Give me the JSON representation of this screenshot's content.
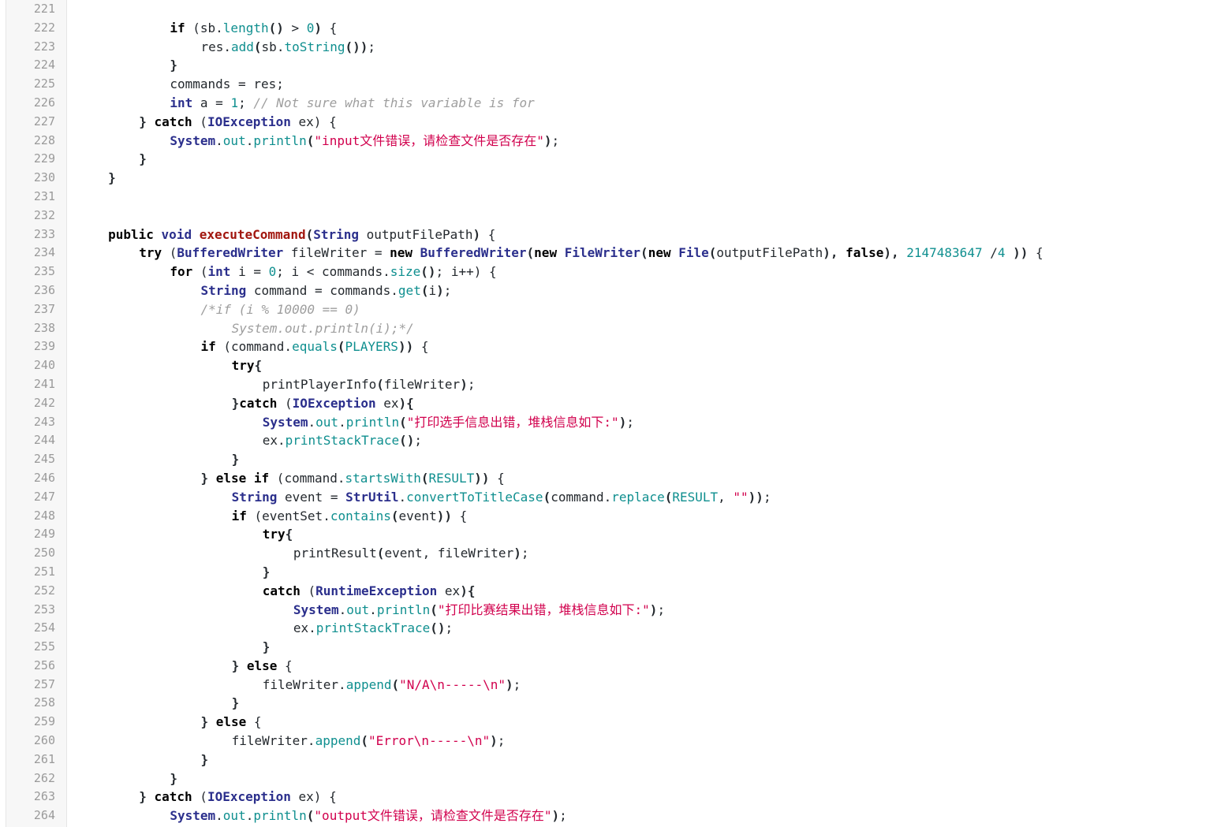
{
  "colors": {
    "keyword": "#000000",
    "type": "#2b2f8c",
    "method": "#0f8f8f",
    "number": "#0f8f8f",
    "string": "#d1004d",
    "comment": "#9e9e9e",
    "declaration": "#a1160e",
    "plain": "#24292e",
    "gutter_bg": "#f7f7f7",
    "line_number": "#9a9a9a"
  },
  "lines": [
    {
      "n": "221",
      "indent": 0,
      "tokens": []
    },
    {
      "n": "222",
      "indent": 12,
      "tokens": [
        [
          "k",
          "if"
        ],
        [
          "p",
          " ("
        ],
        [
          "p",
          "sb."
        ],
        [
          "f",
          "length"
        ],
        [
          "o",
          "()"
        ],
        [
          "p",
          " > "
        ],
        [
          "n",
          "0"
        ],
        [
          "o",
          ")"
        ],
        [
          "p",
          " {"
        ]
      ]
    },
    {
      "n": "223",
      "indent": 16,
      "tokens": [
        [
          "p",
          "res."
        ],
        [
          "f",
          "add"
        ],
        [
          "o",
          "("
        ],
        [
          "p",
          "sb."
        ],
        [
          "f",
          "toString"
        ],
        [
          "o",
          "())"
        ],
        [
          "p",
          ";"
        ]
      ]
    },
    {
      "n": "224",
      "indent": 12,
      "tokens": [
        [
          "o",
          "}"
        ]
      ]
    },
    {
      "n": "225",
      "indent": 12,
      "tokens": [
        [
          "p",
          "commands = res;"
        ]
      ]
    },
    {
      "n": "226",
      "indent": 12,
      "tokens": [
        [
          "t",
          "int"
        ],
        [
          "p",
          " a = "
        ],
        [
          "n",
          "1"
        ],
        [
          "p",
          "; "
        ],
        [
          "c",
          "// Not sure what this variable is for"
        ]
      ]
    },
    {
      "n": "227",
      "indent": 8,
      "tokens": [
        [
          "o",
          "} "
        ],
        [
          "k",
          "catch"
        ],
        [
          "p",
          " ("
        ],
        [
          "t",
          "IOException"
        ],
        [
          "p",
          " ex) {"
        ]
      ]
    },
    {
      "n": "228",
      "indent": 12,
      "tokens": [
        [
          "t",
          "System"
        ],
        [
          "p",
          "."
        ],
        [
          "f",
          "out"
        ],
        [
          "p",
          "."
        ],
        [
          "f",
          "println"
        ],
        [
          "o",
          "("
        ],
        [
          "s",
          "\"input文件错误，请检查文件是否存在\""
        ],
        [
          "o",
          ")"
        ],
        [
          "p",
          ";"
        ]
      ]
    },
    {
      "n": "229",
      "indent": 8,
      "tokens": [
        [
          "o",
          "}"
        ]
      ]
    },
    {
      "n": "230",
      "indent": 4,
      "tokens": [
        [
          "o",
          "}"
        ]
      ]
    },
    {
      "n": "231",
      "indent": 0,
      "tokens": []
    },
    {
      "n": "232",
      "indent": 0,
      "tokens": []
    },
    {
      "n": "233",
      "indent": 4,
      "tokens": [
        [
          "k",
          "public"
        ],
        [
          "p",
          " "
        ],
        [
          "t",
          "void"
        ],
        [
          "p",
          " "
        ],
        [
          "d",
          "executeCommand"
        ],
        [
          "o",
          "("
        ],
        [
          "t",
          "String"
        ],
        [
          "p",
          " outputFilePath"
        ],
        [
          "o",
          ")"
        ],
        [
          "p",
          " {"
        ]
      ]
    },
    {
      "n": "234",
      "indent": 8,
      "tokens": [
        [
          "k",
          "try"
        ],
        [
          "p",
          " ("
        ],
        [
          "t",
          "BufferedWriter"
        ],
        [
          "p",
          " fileWriter = "
        ],
        [
          "k",
          "new"
        ],
        [
          "p",
          " "
        ],
        [
          "t",
          "BufferedWriter"
        ],
        [
          "o",
          "("
        ],
        [
          "k",
          "new"
        ],
        [
          "p",
          " "
        ],
        [
          "t",
          "FileWriter"
        ],
        [
          "o",
          "("
        ],
        [
          "k",
          "new"
        ],
        [
          "p",
          " "
        ],
        [
          "t",
          "File"
        ],
        [
          "o",
          "("
        ],
        [
          "p",
          "outputFilePath"
        ],
        [
          "o",
          "),"
        ],
        [
          "p",
          " "
        ],
        [
          "k",
          "false"
        ],
        [
          "o",
          "),"
        ],
        [
          "p",
          " "
        ],
        [
          "n",
          "2147483647"
        ],
        [
          "p",
          " /"
        ],
        [
          "n",
          "4"
        ],
        [
          "p",
          " "
        ],
        [
          "o",
          "))"
        ],
        [
          "p",
          " {"
        ]
      ]
    },
    {
      "n": "235",
      "indent": 12,
      "tokens": [
        [
          "k",
          "for"
        ],
        [
          "p",
          " ("
        ],
        [
          "t",
          "int"
        ],
        [
          "p",
          " i = "
        ],
        [
          "n",
          "0"
        ],
        [
          "p",
          "; i < commands."
        ],
        [
          "f",
          "size"
        ],
        [
          "o",
          "()"
        ],
        [
          "p",
          "; i++) {"
        ]
      ]
    },
    {
      "n": "236",
      "indent": 16,
      "tokens": [
        [
          "t",
          "String"
        ],
        [
          "p",
          " command = commands."
        ],
        [
          "f",
          "get"
        ],
        [
          "o",
          "("
        ],
        [
          "p",
          "i"
        ],
        [
          "o",
          ")"
        ],
        [
          "p",
          ";"
        ]
      ]
    },
    {
      "n": "237",
      "indent": 16,
      "tokens": [
        [
          "c",
          "/*if (i % 10000 == 0)"
        ]
      ]
    },
    {
      "n": "238",
      "indent": 20,
      "tokens": [
        [
          "c",
          "System.out.println(i);*/"
        ]
      ]
    },
    {
      "n": "239",
      "indent": 16,
      "tokens": [
        [
          "k",
          "if"
        ],
        [
          "p",
          " (command."
        ],
        [
          "f",
          "equals"
        ],
        [
          "o",
          "("
        ],
        [
          "f",
          "PLAYERS"
        ],
        [
          "o",
          "))"
        ],
        [
          "p",
          " {"
        ]
      ]
    },
    {
      "n": "240",
      "indent": 20,
      "tokens": [
        [
          "k",
          "try"
        ],
        [
          "o",
          "{"
        ]
      ]
    },
    {
      "n": "241",
      "indent": 24,
      "tokens": [
        [
          "p",
          "printPlayerInfo"
        ],
        [
          "o",
          "("
        ],
        [
          "p",
          "fileWriter"
        ],
        [
          "o",
          ")"
        ],
        [
          "p",
          ";"
        ]
      ]
    },
    {
      "n": "242",
      "indent": 20,
      "tokens": [
        [
          "o",
          "}"
        ],
        [
          "k",
          "catch"
        ],
        [
          "p",
          " ("
        ],
        [
          "t",
          "IOException"
        ],
        [
          "p",
          " ex"
        ],
        [
          "o",
          "){"
        ]
      ]
    },
    {
      "n": "243",
      "indent": 24,
      "tokens": [
        [
          "t",
          "System"
        ],
        [
          "p",
          "."
        ],
        [
          "f",
          "out"
        ],
        [
          "p",
          "."
        ],
        [
          "f",
          "println"
        ],
        [
          "o",
          "("
        ],
        [
          "s",
          "\"打印选手信息出错，堆栈信息如下:\""
        ],
        [
          "o",
          ")"
        ],
        [
          "p",
          ";"
        ]
      ]
    },
    {
      "n": "244",
      "indent": 24,
      "tokens": [
        [
          "p",
          "ex."
        ],
        [
          "f",
          "printStackTrace"
        ],
        [
          "o",
          "()"
        ],
        [
          "p",
          ";"
        ]
      ]
    },
    {
      "n": "245",
      "indent": 20,
      "tokens": [
        [
          "o",
          "}"
        ]
      ]
    },
    {
      "n": "246",
      "indent": 16,
      "tokens": [
        [
          "o",
          "} "
        ],
        [
          "k",
          "else if"
        ],
        [
          "p",
          " (command."
        ],
        [
          "f",
          "startsWith"
        ],
        [
          "o",
          "("
        ],
        [
          "f",
          "RESULT"
        ],
        [
          "o",
          "))"
        ],
        [
          "p",
          " {"
        ]
      ]
    },
    {
      "n": "247",
      "indent": 20,
      "tokens": [
        [
          "t",
          "String"
        ],
        [
          "p",
          " event = "
        ],
        [
          "t",
          "StrUtil"
        ],
        [
          "p",
          "."
        ],
        [
          "f",
          "convertToTitleCase"
        ],
        [
          "o",
          "("
        ],
        [
          "p",
          "command."
        ],
        [
          "f",
          "replace"
        ],
        [
          "o",
          "("
        ],
        [
          "f",
          "RESULT"
        ],
        [
          "p",
          ", "
        ],
        [
          "s",
          "\"\""
        ],
        [
          "o",
          "))"
        ],
        [
          "p",
          ";"
        ]
      ]
    },
    {
      "n": "248",
      "indent": 20,
      "tokens": [
        [
          "k",
          "if"
        ],
        [
          "p",
          " (eventSet."
        ],
        [
          "f",
          "contains"
        ],
        [
          "o",
          "("
        ],
        [
          "p",
          "event"
        ],
        [
          "o",
          "))"
        ],
        [
          "p",
          " {"
        ]
      ]
    },
    {
      "n": "249",
      "indent": 24,
      "tokens": [
        [
          "k",
          "try"
        ],
        [
          "o",
          "{"
        ]
      ]
    },
    {
      "n": "250",
      "indent": 28,
      "tokens": [
        [
          "p",
          "printResult"
        ],
        [
          "o",
          "("
        ],
        [
          "p",
          "event, fileWriter"
        ],
        [
          "o",
          ")"
        ],
        [
          "p",
          ";"
        ]
      ]
    },
    {
      "n": "251",
      "indent": 24,
      "tokens": [
        [
          "o",
          "}"
        ]
      ]
    },
    {
      "n": "252",
      "indent": 24,
      "tokens": [
        [
          "k",
          "catch"
        ],
        [
          "p",
          " ("
        ],
        [
          "t",
          "RuntimeException"
        ],
        [
          "p",
          " ex"
        ],
        [
          "o",
          "){"
        ]
      ]
    },
    {
      "n": "253",
      "indent": 28,
      "tokens": [
        [
          "t",
          "System"
        ],
        [
          "p",
          "."
        ],
        [
          "f",
          "out"
        ],
        [
          "p",
          "."
        ],
        [
          "f",
          "println"
        ],
        [
          "o",
          "("
        ],
        [
          "s",
          "\"打印比赛结果出错，堆栈信息如下:\""
        ],
        [
          "o",
          ")"
        ],
        [
          "p",
          ";"
        ]
      ]
    },
    {
      "n": "254",
      "indent": 28,
      "tokens": [
        [
          "p",
          "ex."
        ],
        [
          "f",
          "printStackTrace"
        ],
        [
          "o",
          "()"
        ],
        [
          "p",
          ";"
        ]
      ]
    },
    {
      "n": "255",
      "indent": 24,
      "tokens": [
        [
          "o",
          "}"
        ]
      ]
    },
    {
      "n": "256",
      "indent": 20,
      "tokens": [
        [
          "o",
          "} "
        ],
        [
          "k",
          "else"
        ],
        [
          "p",
          " {"
        ]
      ]
    },
    {
      "n": "257",
      "indent": 24,
      "tokens": [
        [
          "p",
          "fileWriter."
        ],
        [
          "f",
          "append"
        ],
        [
          "o",
          "("
        ],
        [
          "s",
          "\"N/A\\n-----\\n\""
        ],
        [
          "o",
          ")"
        ],
        [
          "p",
          ";"
        ]
      ]
    },
    {
      "n": "258",
      "indent": 20,
      "tokens": [
        [
          "o",
          "}"
        ]
      ]
    },
    {
      "n": "259",
      "indent": 16,
      "tokens": [
        [
          "o",
          "} "
        ],
        [
          "k",
          "else"
        ],
        [
          "p",
          " {"
        ]
      ]
    },
    {
      "n": "260",
      "indent": 20,
      "tokens": [
        [
          "p",
          "fileWriter."
        ],
        [
          "f",
          "append"
        ],
        [
          "o",
          "("
        ],
        [
          "s",
          "\"Error\\n-----\\n\""
        ],
        [
          "o",
          ")"
        ],
        [
          "p",
          ";"
        ]
      ]
    },
    {
      "n": "261",
      "indent": 16,
      "tokens": [
        [
          "o",
          "}"
        ]
      ]
    },
    {
      "n": "262",
      "indent": 12,
      "tokens": [
        [
          "o",
          "}"
        ]
      ]
    },
    {
      "n": "263",
      "indent": 8,
      "tokens": [
        [
          "o",
          "} "
        ],
        [
          "k",
          "catch"
        ],
        [
          "p",
          " ("
        ],
        [
          "t",
          "IOException"
        ],
        [
          "p",
          " ex) {"
        ]
      ]
    },
    {
      "n": "264",
      "indent": 12,
      "tokens": [
        [
          "t",
          "System"
        ],
        [
          "p",
          "."
        ],
        [
          "f",
          "out"
        ],
        [
          "p",
          "."
        ],
        [
          "f",
          "println"
        ],
        [
          "o",
          "("
        ],
        [
          "s",
          "\"output文件错误，请检查文件是否存在\""
        ],
        [
          "o",
          ")"
        ],
        [
          "p",
          ";"
        ]
      ]
    }
  ]
}
